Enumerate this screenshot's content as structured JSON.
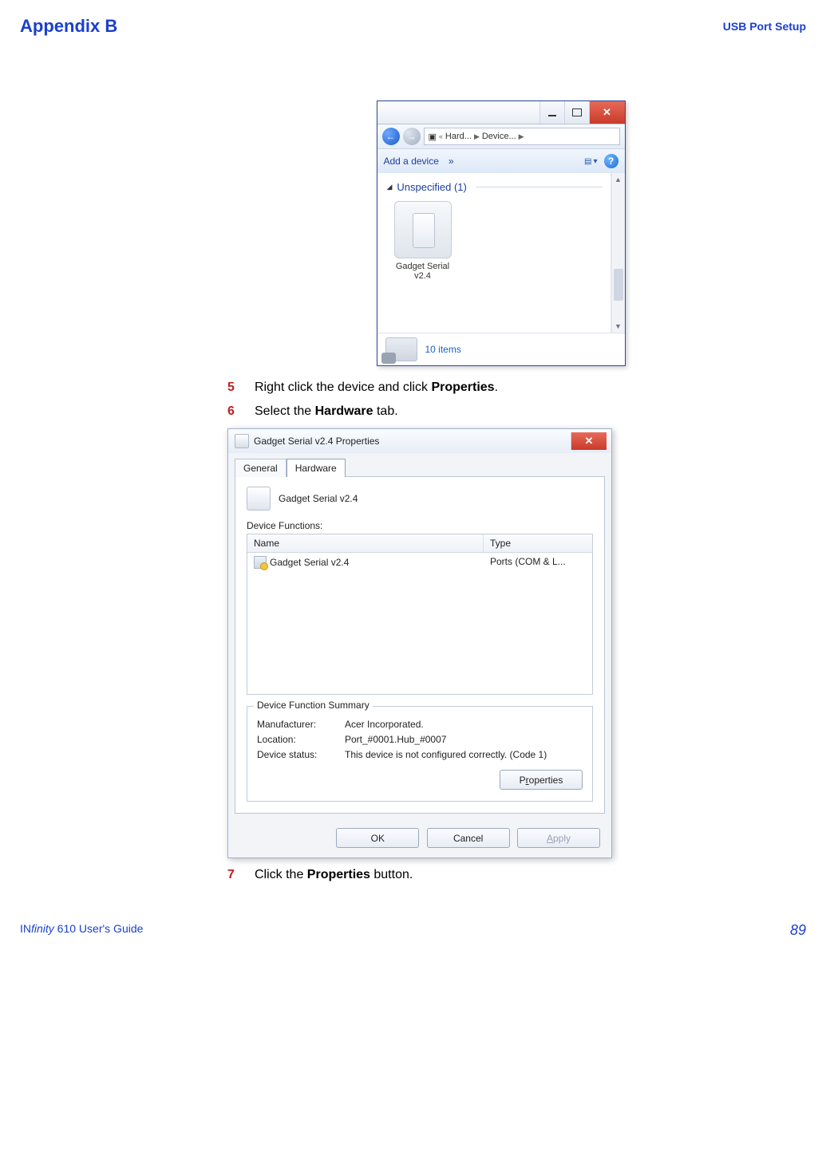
{
  "header": {
    "appendix": "Appendix B",
    "topic": "USB Port Setup"
  },
  "steps": {
    "s5": {
      "num": "5",
      "pre": "Right click the device and click ",
      "bold": "Properties",
      "post": "."
    },
    "s6": {
      "num": "6",
      "pre": "Select the ",
      "bold": "Hardware",
      "post": " tab."
    },
    "s7": {
      "num": "7",
      "pre": "Click the ",
      "bold": "Properties",
      "post": " button."
    }
  },
  "win1": {
    "crumbs": {
      "a": "Hard...",
      "b": "Device..."
    },
    "cmdbar": {
      "add": "Add a device",
      "chev": "»"
    },
    "category": {
      "label": "Unspecified (1)"
    },
    "device": {
      "line1": "Gadget Serial",
      "line2": "v2.4"
    },
    "status": {
      "count": "10 items"
    }
  },
  "win2": {
    "title": "Gadget Serial v2.4 Properties",
    "tabs": {
      "general": "General",
      "hardware": "Hardware"
    },
    "device_name": "Gadget Serial v2.4",
    "functions_label": "Device Functions:",
    "columns": {
      "name": "Name",
      "type": "Type"
    },
    "row": {
      "name": "Gadget Serial v2.4",
      "type": "Ports (COM & L..."
    },
    "summary": {
      "legend": "Device Function Summary",
      "manufacturer_k": "Manufacturer:",
      "manufacturer_v": "Acer Incorporated.",
      "location_k": "Location:",
      "location_v": "Port_#0001.Hub_#0007",
      "status_k": "Device status:",
      "status_v": "This device is not configured correctly. (Code 1)"
    },
    "buttons": {
      "properties_pre": "P",
      "properties_ul": "r",
      "properties_post": "operties",
      "ok": "OK",
      "cancel": "Cancel",
      "apply_ul": "A",
      "apply_post": "pply"
    }
  },
  "footer": {
    "title_italic_pre": "IN",
    "title_italic_mid": "finity",
    "title_rest": " 610 User's Guide",
    "page": "89"
  }
}
